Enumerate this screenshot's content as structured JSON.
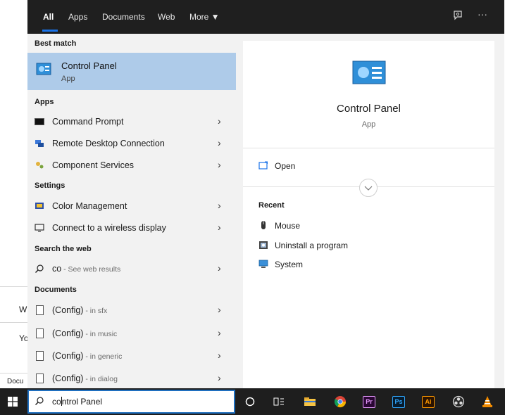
{
  "background": {
    "left_letters": [
      "W",
      "Yo",
      "Docu"
    ]
  },
  "tabs": [
    {
      "label": "All",
      "active": true
    },
    {
      "label": "Apps"
    },
    {
      "label": "Documents"
    },
    {
      "label": "Web"
    },
    {
      "label": "More ▼"
    }
  ],
  "top_right": {
    "feedback_icon": "feedback-icon",
    "more_icon": "ellipsis-icon",
    "ellipsis": "···"
  },
  "left": {
    "best_match": {
      "heading": "Best match",
      "title": "Control Panel",
      "subtitle": "App"
    },
    "apps": {
      "heading": "Apps",
      "items": [
        {
          "label": "Command Prompt",
          "icon": "command-prompt-icon"
        },
        {
          "label": "Remote Desktop Connection",
          "icon": "remote-desktop-icon"
        },
        {
          "label": "Component Services",
          "icon": "component-services-icon"
        }
      ]
    },
    "settings": {
      "heading": "Settings",
      "items": [
        {
          "label": "Color Management",
          "icon": "color-management-icon"
        },
        {
          "label": "Connect to a wireless display",
          "icon": "wireless-display-icon"
        }
      ]
    },
    "web": {
      "heading": "Search the web",
      "item": {
        "label": "co",
        "sub": " - See web results",
        "icon": "search-icon"
      }
    },
    "documents": {
      "heading": "Documents",
      "items": [
        {
          "label": "(Config)",
          "sub": " - in sfx"
        },
        {
          "label": "(Config)",
          "sub": " - in music"
        },
        {
          "label": "(Config)",
          "sub": " - in generic"
        },
        {
          "label": "(Config)",
          "sub": " - in dialog"
        }
      ]
    }
  },
  "right": {
    "title": "Control Panel",
    "subtitle": "App",
    "open_label": "Open",
    "recent_heading": "Recent",
    "recent_items": [
      {
        "label": "Mouse",
        "icon": "mouse-icon"
      },
      {
        "label": "Uninstall a program",
        "icon": "uninstall-program-icon"
      },
      {
        "label": "System",
        "icon": "system-icon"
      }
    ]
  },
  "taskbar": {
    "search_text_typed": "co",
    "search_text_rest": "ntrol Panel",
    "adobe": {
      "premiere": "Pr",
      "photoshop": "Ps",
      "illustrator": "Ai"
    }
  },
  "colors": {
    "highlight": "#aecbe9",
    "topbar": "#1f1f1f",
    "accent": "#1a73e8"
  }
}
